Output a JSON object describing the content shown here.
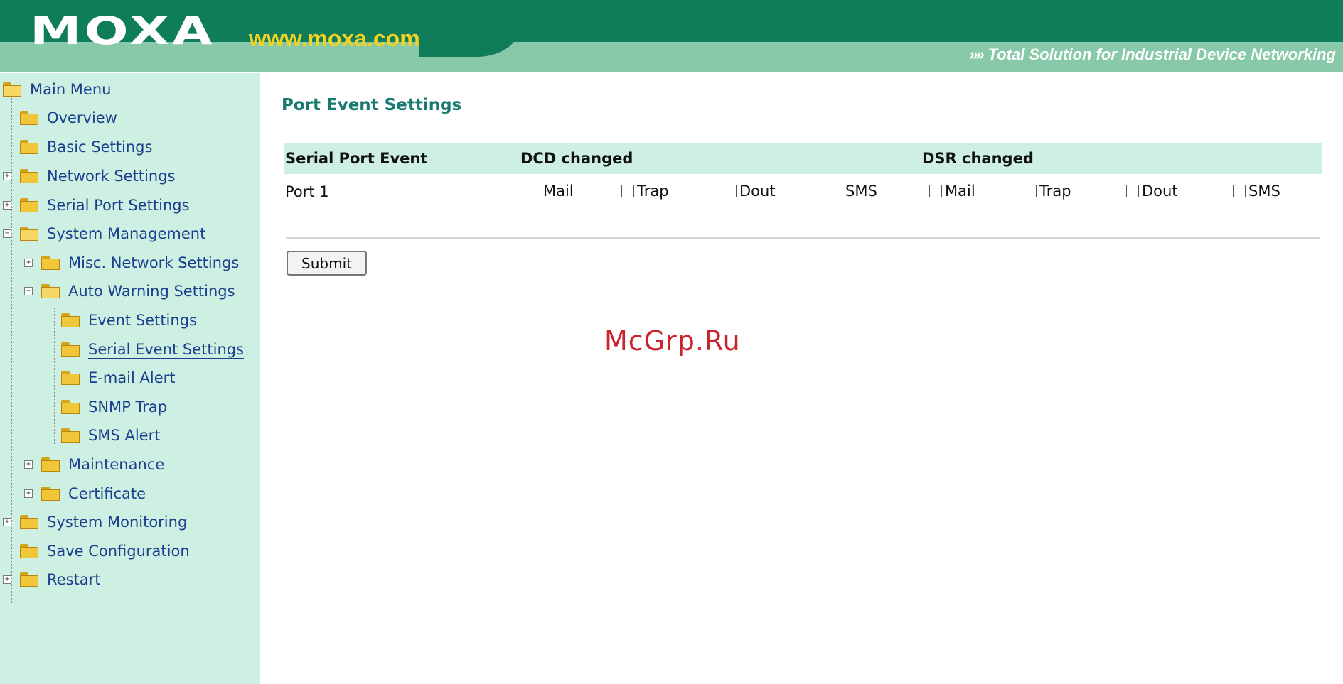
{
  "header": {
    "logo": "MOXA",
    "url": "www.moxa.com",
    "tagline_arrows": "»»",
    "tagline": "Total Solution for Industrial Device Networking"
  },
  "colors": {
    "header_dark": "#0f7d5a",
    "header_light": "#88c9a9",
    "sidebar_bg": "#cdf0e2",
    "link": "#1b3f8f",
    "title": "#1a7a72",
    "watermark": "#c9242d"
  },
  "sidebar": {
    "items": [
      {
        "label": "Main Menu",
        "icon": "folder-open-icon"
      },
      {
        "label": "Overview",
        "icon": "folder-icon"
      },
      {
        "label": "Basic Settings",
        "icon": "folder-icon"
      },
      {
        "label": "Network Settings",
        "icon": "folder-icon"
      },
      {
        "label": "Serial Port Settings",
        "icon": "folder-icon"
      },
      {
        "label": "System Management",
        "icon": "folder-open-icon"
      },
      {
        "label": "Misc. Network Settings",
        "icon": "folder-icon"
      },
      {
        "label": "Auto Warning Settings",
        "icon": "folder-open-icon"
      },
      {
        "label": "Event Settings",
        "icon": "folder-icon"
      },
      {
        "label": "Serial Event Settings",
        "icon": "folder-icon"
      },
      {
        "label": "E-mail Alert",
        "icon": "folder-icon"
      },
      {
        "label": "SNMP Trap",
        "icon": "folder-icon"
      },
      {
        "label": "SMS Alert",
        "icon": "folder-icon"
      },
      {
        "label": "Maintenance",
        "icon": "folder-icon"
      },
      {
        "label": "Certificate",
        "icon": "folder-icon"
      },
      {
        "label": "System Monitoring",
        "icon": "folder-icon"
      },
      {
        "label": "Save Configuration",
        "icon": "folder-icon"
      },
      {
        "label": "Restart",
        "icon": "folder-icon"
      }
    ],
    "selected": "Serial Event Settings"
  },
  "main": {
    "title": "Port Event Settings",
    "table": {
      "headers": [
        "Serial Port Event",
        "DCD changed",
        "DSR changed"
      ],
      "rows": [
        {
          "port": "Port 1",
          "dcd": [
            {
              "label": "Mail",
              "checked": false
            },
            {
              "label": "Trap",
              "checked": false
            },
            {
              "label": "Dout",
              "checked": false
            },
            {
              "label": "SMS",
              "checked": false
            }
          ],
          "dsr": [
            {
              "label": "Mail",
              "checked": false
            },
            {
              "label": "Trap",
              "checked": false
            },
            {
              "label": "Dout",
              "checked": false
            },
            {
              "label": "SMS",
              "checked": false
            }
          ]
        }
      ]
    },
    "submit_label": "Submit"
  },
  "watermark": "McGrp.Ru"
}
